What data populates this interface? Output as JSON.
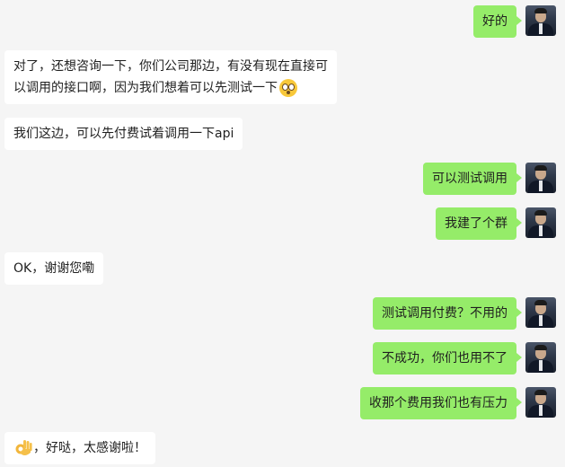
{
  "messages": [
    {
      "side": "right",
      "text": "好的"
    },
    {
      "side": "left",
      "text_line1": "对了，还想咨询一下，你们公司那边，有没有现在直接可",
      "text_line2": "以调用的接口啊，因为我们想着可以先测试一下",
      "emoji": "flushed-face"
    },
    {
      "side": "left",
      "text": "我们这边，可以先付费试着调用一下api"
    },
    {
      "side": "right",
      "text": "可以测试调用"
    },
    {
      "side": "right",
      "text": "我建了个群"
    },
    {
      "side": "left",
      "text": "OK，谢谢您嘞"
    },
    {
      "side": "right",
      "text": "测试调用付费？不用的"
    },
    {
      "side": "right",
      "text": "不成功，你们也用不了"
    },
    {
      "side": "right",
      "text": "收那个费用我们也有压力"
    },
    {
      "side": "left",
      "emoji": "ok-hand",
      "text": "，好哒，太感谢啦！"
    }
  ],
  "colors": {
    "self_bubble": "#95ec69",
    "other_bubble": "#ffffff",
    "background": "#f5f5f5"
  }
}
